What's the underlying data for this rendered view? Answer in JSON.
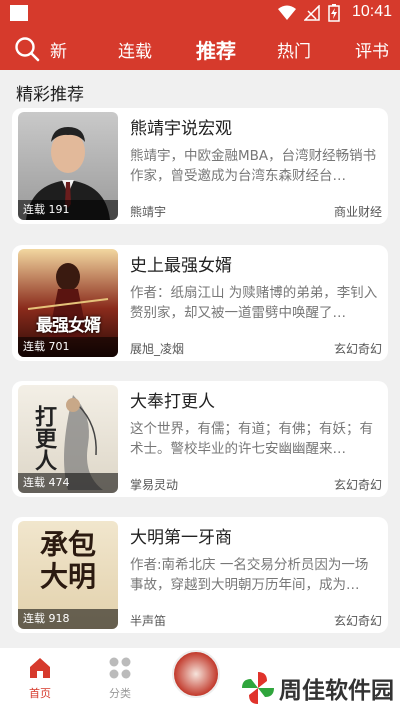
{
  "status_bar": {
    "time": "10:41"
  },
  "top_nav": {
    "tabs": [
      {
        "label": "新"
      },
      {
        "label": "连载"
      },
      {
        "label": "推荐"
      },
      {
        "label": "热门"
      },
      {
        "label": "评书"
      }
    ],
    "active_tab": "推荐"
  },
  "section": {
    "title": "精彩推荐"
  },
  "books": [
    {
      "title": "熊靖宇说宏观",
      "description": "熊靖宇，中欧金融MBA，台湾财经畅销书作家，曾受邀成为台湾东森财经台…",
      "badge": "连载 191",
      "author": "熊靖宇",
      "genre": "商业财经"
    },
    {
      "title": "史上最强女婿",
      "description": "作者：纸扇江山 为赎赌博的弟弟，李钊入赘别家，却又被一道雷劈中唤醒了…",
      "badge": "连载 701",
      "author": "展旭_凌烟",
      "genre": "玄幻奇幻",
      "cover_text": "最强女婿"
    },
    {
      "title": "大奉打更人",
      "description": "这个世界，有儒；有道；有佛；有妖；有术士。警校毕业的许七安幽幽醒来…",
      "badge": "连载 474",
      "author": "掌易灵动",
      "genre": "玄幻奇幻",
      "cover_text": "打更人"
    },
    {
      "title": "大明第一牙商",
      "description": "作者:南希北庆 一名交易分析员因为一场事故，穿越到大明朝万历年间，成为…",
      "badge": "连载 918",
      "author": "半声笛",
      "genre": "玄幻奇幻",
      "cover_text": "承包大明"
    }
  ],
  "bottom_nav": {
    "items": [
      {
        "label": "首页"
      },
      {
        "label": "分类"
      }
    ]
  },
  "watermark": {
    "text": "周佳软件园"
  },
  "colors": {
    "brand_red": "#d63a2c",
    "card_bg": "#ffffff",
    "page_bg": "#f0f0f0"
  }
}
